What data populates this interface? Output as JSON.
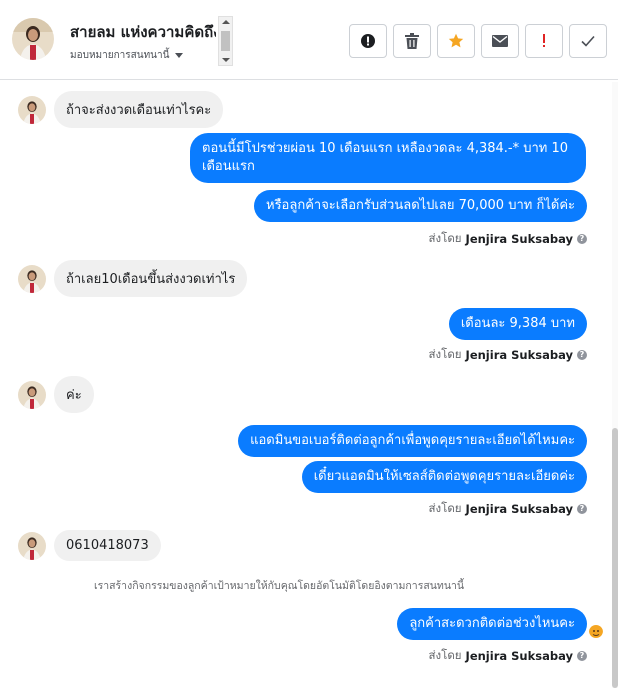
{
  "header": {
    "contact_name": "สายลม แห่งความคิดถึง",
    "assign_label": "มอบหมายการสนทนานี้",
    "actions": [
      {
        "name": "mark-spam-button",
        "icon": "alert-circle-icon"
      },
      {
        "name": "delete-button",
        "icon": "trash-icon"
      },
      {
        "name": "star-button",
        "icon": "star-icon"
      },
      {
        "name": "mark-unread-button",
        "icon": "envelope-icon"
      },
      {
        "name": "follow-up-button",
        "icon": "exclamation-icon"
      },
      {
        "name": "mark-done-button",
        "icon": "check-icon"
      }
    ]
  },
  "colors": {
    "outgoing": "#0a7cff",
    "incoming": "#f0f0f0",
    "star": "#f5a623",
    "flag": "#e02424"
  },
  "messages": {
    "m1": "ถ้าจะส่งงวดเดือนเท่าไรคะ",
    "m2_line1": "ตอนนี้มีโปรช่วยผ่อน 10 เดือนแรก เหลืองวดละ 4,384.-* บาท 10",
    "m2_line2": "เดือนแรก",
    "m3": "หรือลูกค้าจะเลือกรับส่วนลดไปเลย 70,000 บาท ก็ได้ค่ะ",
    "m4": "ถ้าเลย10เดือนขึ้นส่งงวดเท่าไร",
    "m5": "เดือนละ 9,384 บาท",
    "m6": "ค่ะ",
    "m7": "แอดมินขอเบอร์ติดต่อลูกค้าเพื่อพูดคุยรายละเอียดได้ไหมคะ",
    "m8": "เดี๋ยวแอดมินให้เซลส์ติดต่อพูดคุยรายละเอียดค่ะ",
    "m9": "0610418073",
    "m10": "ลูกค้าสะดวกติดต่อช่วงไหนคะ"
  },
  "sent_by": {
    "prefix": "ส่งโดย",
    "agent": "Jenjira Suksabay"
  },
  "system_note": "เราสร้างกิจกรรมของลูกค้าเป้าหมายให้กับคุณโดยอัตโนมัติโดยอิงตามการสนทนานี้"
}
